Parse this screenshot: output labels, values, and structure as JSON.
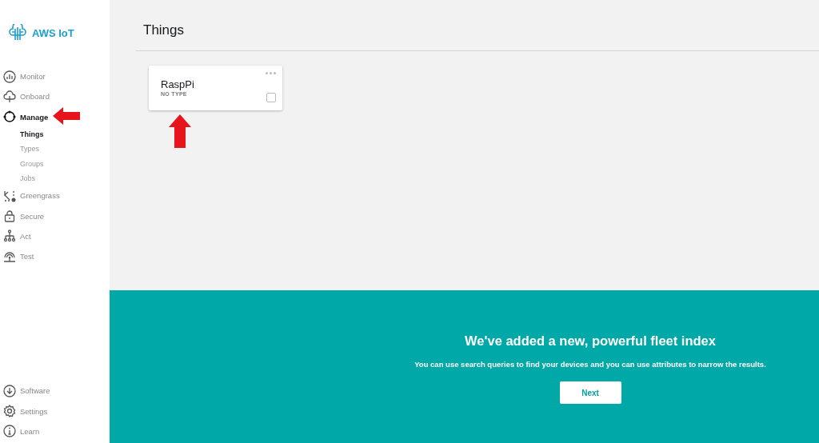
{
  "sidebar": {
    "brand": "AWS IoT",
    "items": [
      {
        "label": "Monitor",
        "kind": "monitor",
        "selected": false
      },
      {
        "label": "Onboard",
        "kind": "cloud",
        "selected": false
      },
      {
        "label": "Manage",
        "kind": "manage",
        "selected": true,
        "children": [
          {
            "label": "Things",
            "selected": true
          },
          {
            "label": "Types",
            "selected": false
          },
          {
            "label": "Groups",
            "selected": false
          },
          {
            "label": "Jobs",
            "selected": false
          }
        ]
      },
      {
        "label": "Greengrass",
        "kind": "greengrass",
        "selected": false
      },
      {
        "label": "Secure",
        "kind": "lock",
        "selected": false
      },
      {
        "label": "Act",
        "kind": "tree",
        "selected": false
      },
      {
        "label": "Test",
        "kind": "signal",
        "selected": false
      }
    ],
    "bottom_items": [
      {
        "label": "Software",
        "kind": "download",
        "selected": false
      },
      {
        "label": "Settings",
        "kind": "gear",
        "selected": false
      },
      {
        "label": "Learn",
        "kind": "info",
        "selected": false
      }
    ]
  },
  "page": {
    "title": "Things",
    "things": [
      {
        "name": "RaspPi",
        "type": "NO TYPE",
        "checked": false
      }
    ]
  },
  "banner": {
    "title": "We've added a new, powerful fleet index",
    "text": "You can use search queries to find your devices and you can use attributes to narrow the results.",
    "button": "Next"
  }
}
